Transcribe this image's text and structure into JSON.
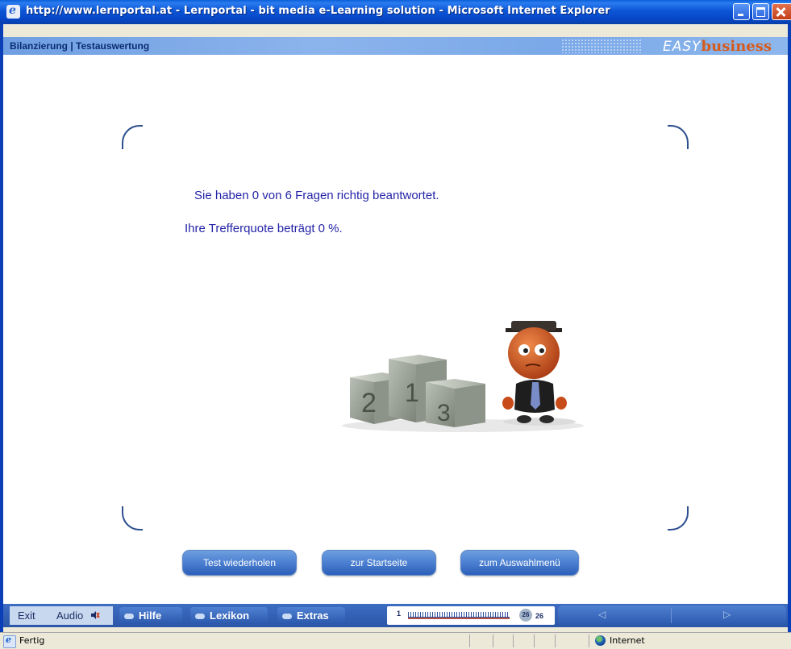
{
  "window": {
    "title": "http://www.lernportal.at - Lernportal - bit media e-Learning solution - Microsoft Internet Explorer"
  },
  "header": {
    "breadcrumb": "Bilanzierung | Testauswertung",
    "brand_easy": "EASY",
    "brand_business": "business"
  },
  "result": {
    "line1": "Sie haben 0 von 6 Fragen richtig beantwortet.",
    "line2": "Ihre Trefferquote beträgt 0 %."
  },
  "illustration": {
    "podium_numbers": [
      "2",
      "1",
      "3"
    ]
  },
  "buttons": {
    "repeat": "Test wiederholen",
    "start": "zur Startseite",
    "menu": "zum Auswahlmenü"
  },
  "navbar": {
    "exit": "Exit",
    "audio": "Audio",
    "hilfe": "Hilfe",
    "lexikon": "Lexikon",
    "extras": "Extras",
    "progress_start": "1",
    "progress_current": "26",
    "progress_total": "26"
  },
  "status": {
    "text": "Fertig",
    "zone": "Internet"
  },
  "colors": {
    "result_text": "#2424a8",
    "brand_business": "#d65a1a",
    "titlebar": "#0646c6"
  }
}
